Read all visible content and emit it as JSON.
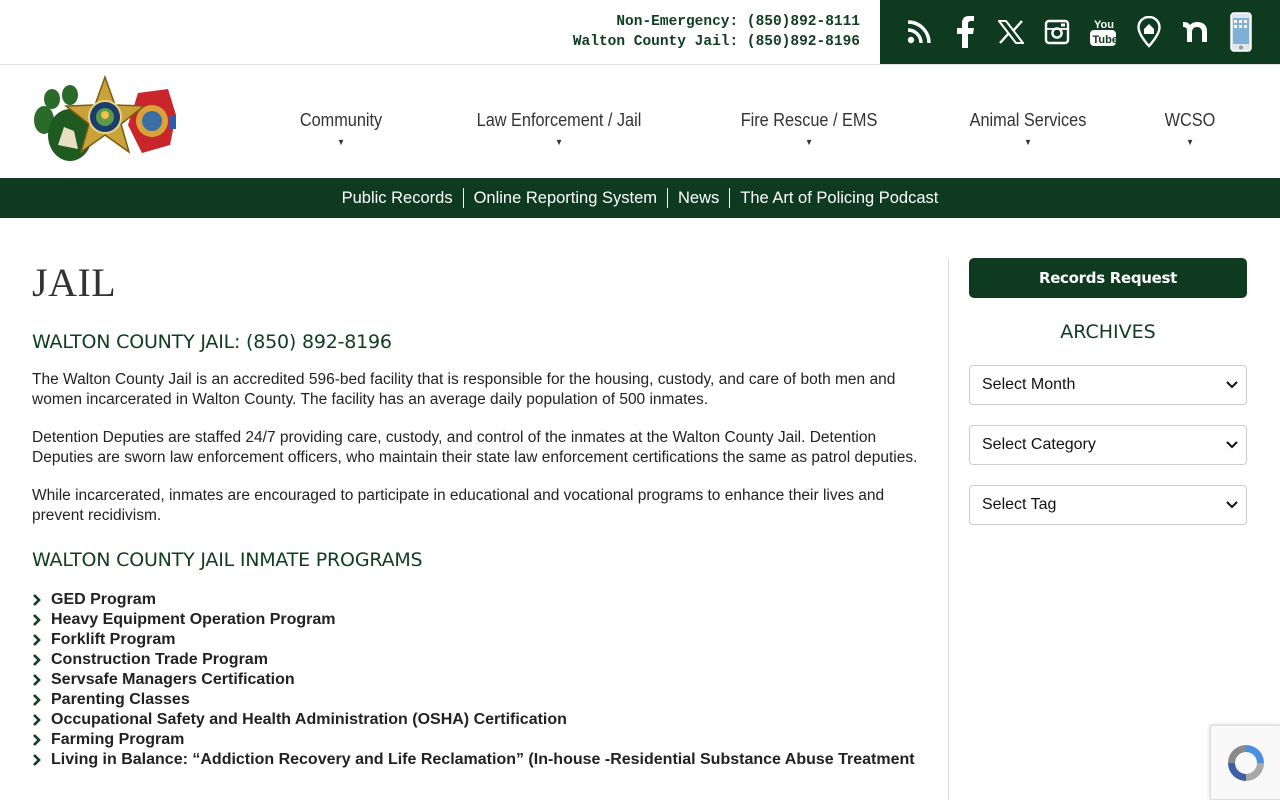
{
  "contact": {
    "line1": "Non-Emergency: (850)892-8111",
    "line2": "Walton County Jail: (850)892-8196"
  },
  "social_icons": [
    "rss-icon",
    "facebook-icon",
    "x-icon",
    "instagram-icon",
    "youtube-icon",
    "location-icon",
    "nextdoor-icon",
    "mobile-app-icon"
  ],
  "main_nav": [
    {
      "label": "Community"
    },
    {
      "label": "Law Enforcement / Jail"
    },
    {
      "label": "Fire Rescue / EMS"
    },
    {
      "label": "Animal Services"
    },
    {
      "label": "WCSO"
    }
  ],
  "sub_nav": [
    "Public Records",
    "Online Reporting System",
    "News",
    "The Art of Policing Podcast"
  ],
  "page": {
    "title": "JAIL",
    "subtitle": "WALTON COUNTY JAIL: (850) 892-8196",
    "paragraphs": [
      "The Walton County Jail is an accredited 596-bed facility that is responsible for the housing, custody, and care of both men and women incarcerated in Walton County. The facility has an average daily population of 500 inmates.",
      "Detention Deputies are staffed 24/7 providing care, custody, and control of the inmates at the Walton County Jail. Detention Deputies are sworn law enforcement officers, who maintain their state law enforcement certifications the same as patrol deputies.",
      "While incarcerated, inmates are encouraged to participate in educational and vocational programs to enhance their lives and prevent recidivism."
    ],
    "programs_heading": "WALTON COUNTY JAIL INMATE PROGRAMS",
    "programs": [
      "GED Program",
      "Heavy Equipment Operation Program",
      "Forklift Program",
      "Construction Trade Program",
      "Servsafe Managers Certification",
      "Parenting Classes",
      "Occupational Safety and Health Administration (OSHA) Certification",
      "Farming Program",
      "Living in Balance: “Addiction Recovery and Life Reclamation” (In-house -Residential Substance Abuse  Treatment"
    ]
  },
  "sidebar": {
    "records_button": "Records Request",
    "archives_title": "ARCHIVES",
    "selects": [
      "Select Month",
      "Select Category",
      "Select Tag"
    ]
  },
  "colors": {
    "brand_green": "#0e3a1f",
    "heading_green": "#0f3d22"
  }
}
